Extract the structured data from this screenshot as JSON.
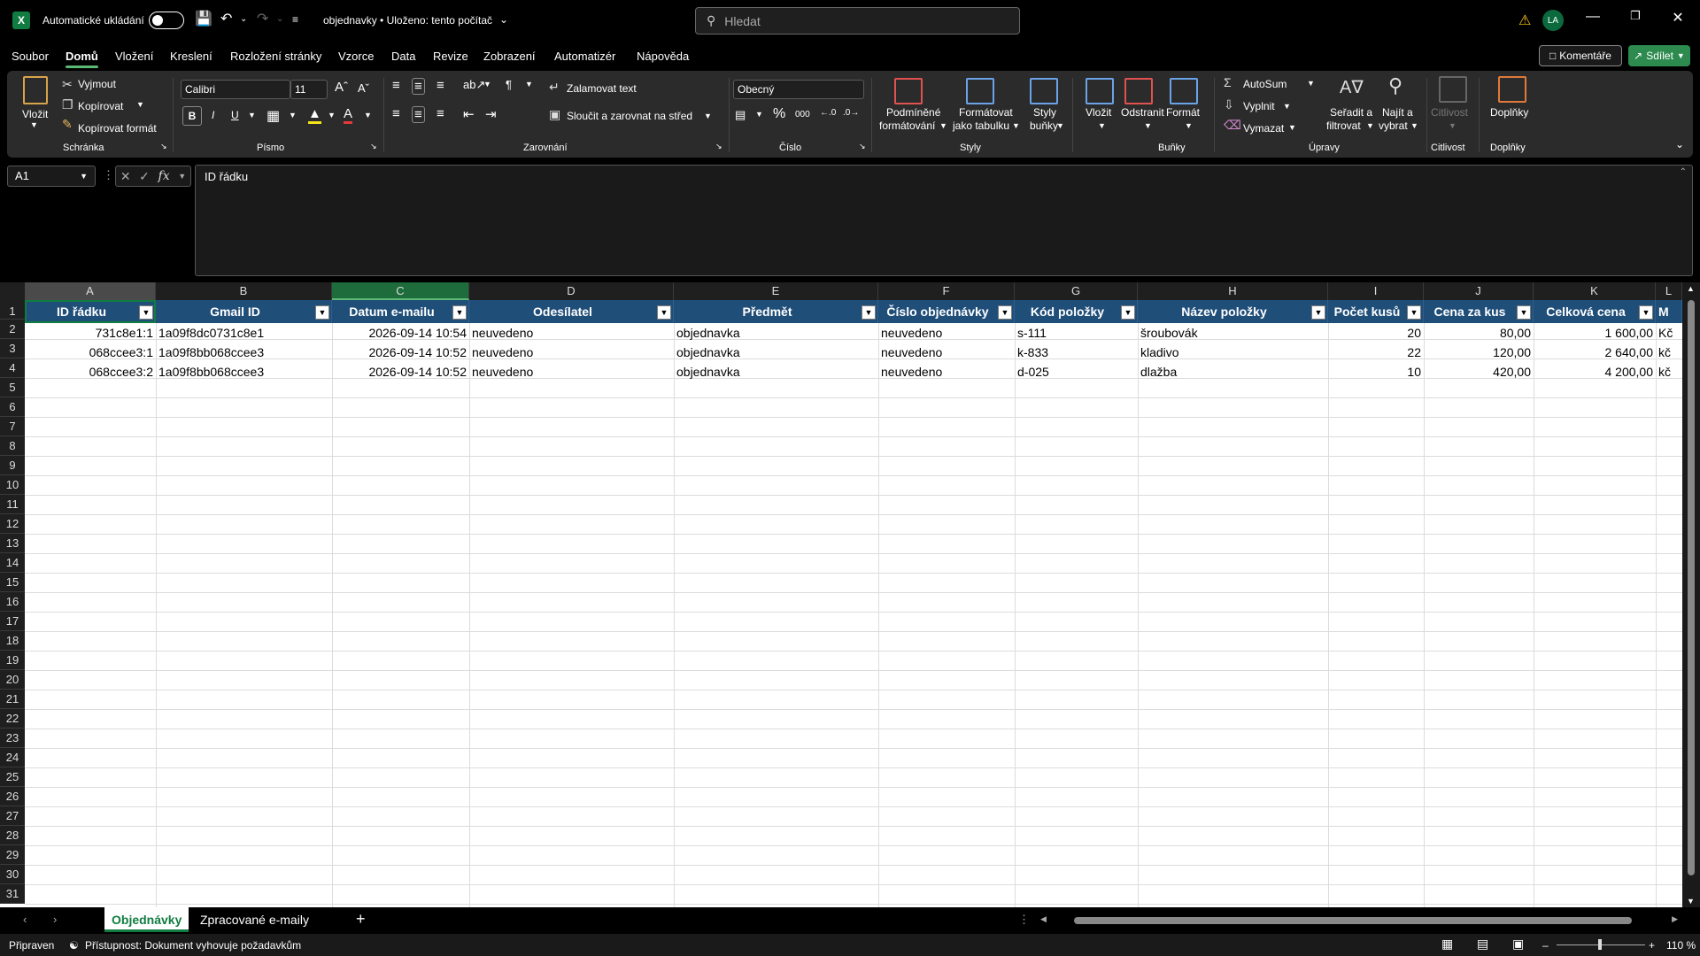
{
  "app": {
    "autosave_label": "Automatické ukládání",
    "doc_title": "objednavky • Uloženo: tento počítač",
    "search_placeholder": "Hledat",
    "user_initials": "LA"
  },
  "menu": {
    "items": [
      "Soubor",
      "Domů",
      "Vložení",
      "Kreslení",
      "Rozložení stránky",
      "Vzorce",
      "Data",
      "Revize",
      "Zobrazení",
      "Automatizér",
      "Nápověda"
    ],
    "active_index": 1,
    "comments_label": "Komentáře",
    "share_label": "Sdílet"
  },
  "ribbon": {
    "clipboard": {
      "paste": "Vložit",
      "cut": "Vyjmout",
      "copy": "Kopírovat",
      "format_painter": "Kopírovat formát",
      "group": "Schránka"
    },
    "font": {
      "name": "Calibri",
      "size": "11",
      "group": "Písmo"
    },
    "alignment": {
      "wrap": "Zalamovat text",
      "merge": "Sloučit a zarovnat na střed",
      "group": "Zarovnání"
    },
    "number": {
      "format": "Obecný",
      "group": "Číslo"
    },
    "styles": {
      "conditional": "Podmíněné",
      "conditional2": "formátování",
      "table": "Formátovat",
      "table2": "jako tabulku",
      "cell": "Styly",
      "cell2": "buňky",
      "group": "Styly"
    },
    "cells": {
      "insert": "Vložit",
      "delete": "Odstranit",
      "format": "Formát",
      "group": "Buňky"
    },
    "editing": {
      "autosum": "AutoSum",
      "fill": "Vyplnit",
      "clear": "Vymazat",
      "sort": "Seřadit a",
      "sort2": "filtrovat",
      "find": "Najít a",
      "find2": "vybrat",
      "group": "Úpravy"
    },
    "sensitivity": {
      "label": "Citlivost",
      "group": "Citlivost"
    },
    "addins": {
      "label": "Doplňky",
      "group": "Doplňky"
    }
  },
  "formula_bar": {
    "cell_ref": "A1",
    "content": "ID řádku"
  },
  "sheet": {
    "columns": [
      "A",
      "B",
      "C",
      "D",
      "E",
      "F",
      "G",
      "H",
      "I",
      "J",
      "K",
      "L"
    ],
    "headers": [
      "ID řádku",
      "Gmail ID",
      "Datum e-mailu",
      "Odesílatel",
      "Předmět",
      "Číslo objednávky",
      "Kód položky",
      "Název položky",
      "Počet kusů",
      "Cena za kus",
      "Celková cena",
      "M"
    ],
    "rows": [
      [
        "731c8e1:1",
        "1a09f8dc0731c8e1",
        "2026-09-14 10:54",
        "neuvedeno",
        "objednavka",
        "neuvedeno",
        "s-111",
        "šroubovák",
        "20",
        "80,00",
        "1 600,00",
        "Kč"
      ],
      [
        "068ccee3:1",
        "1a09f8bb068ccee3",
        "2026-09-14 10:52",
        "neuvedeno",
        "objednavka",
        "neuvedeno",
        "k-833",
        "kladivo",
        "22",
        "120,00",
        "2 640,00",
        "kč"
      ],
      [
        "068ccee3:2",
        "1a09f8bb068ccee3",
        "2026-09-14 10:52",
        "neuvedeno",
        "objednavka",
        "neuvedeno",
        "d-025",
        "dlažba",
        "10",
        "420,00",
        "4 200,00",
        "kč"
      ]
    ],
    "row_numbers": [
      "1",
      "2",
      "3",
      "4",
      "5",
      "6",
      "7",
      "8",
      "9",
      "10",
      "11",
      "12",
      "13",
      "14",
      "15",
      "16",
      "17",
      "18",
      "19",
      "20",
      "21",
      "22",
      "23",
      "24",
      "25",
      "26",
      "27",
      "28",
      "29",
      "30",
      "31"
    ]
  },
  "tabs": {
    "sheets": [
      "Objednávky",
      "Zpracované e-maily"
    ],
    "active_index": 0
  },
  "status": {
    "ready": "Připraven",
    "accessibility": "Přístupnost: Dokument vyhovuje požadavkům",
    "zoom": "110 %"
  }
}
